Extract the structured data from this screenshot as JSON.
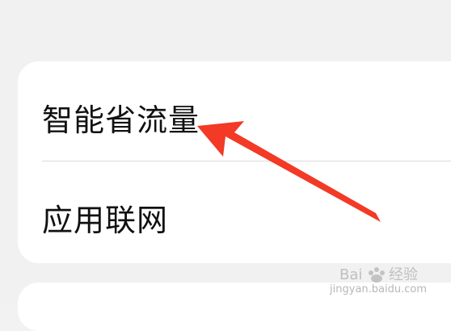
{
  "settings_list": {
    "items": [
      {
        "label": "智能省流量"
      },
      {
        "label": "应用联网"
      }
    ]
  },
  "annotation": {
    "color": "#f23a26"
  },
  "watermark": {
    "text": "jingyan.baidu.com"
  },
  "colors": {
    "background": "#f1f1f1",
    "card": "#ffffff",
    "divider": "#dadada",
    "text": "#111111"
  }
}
